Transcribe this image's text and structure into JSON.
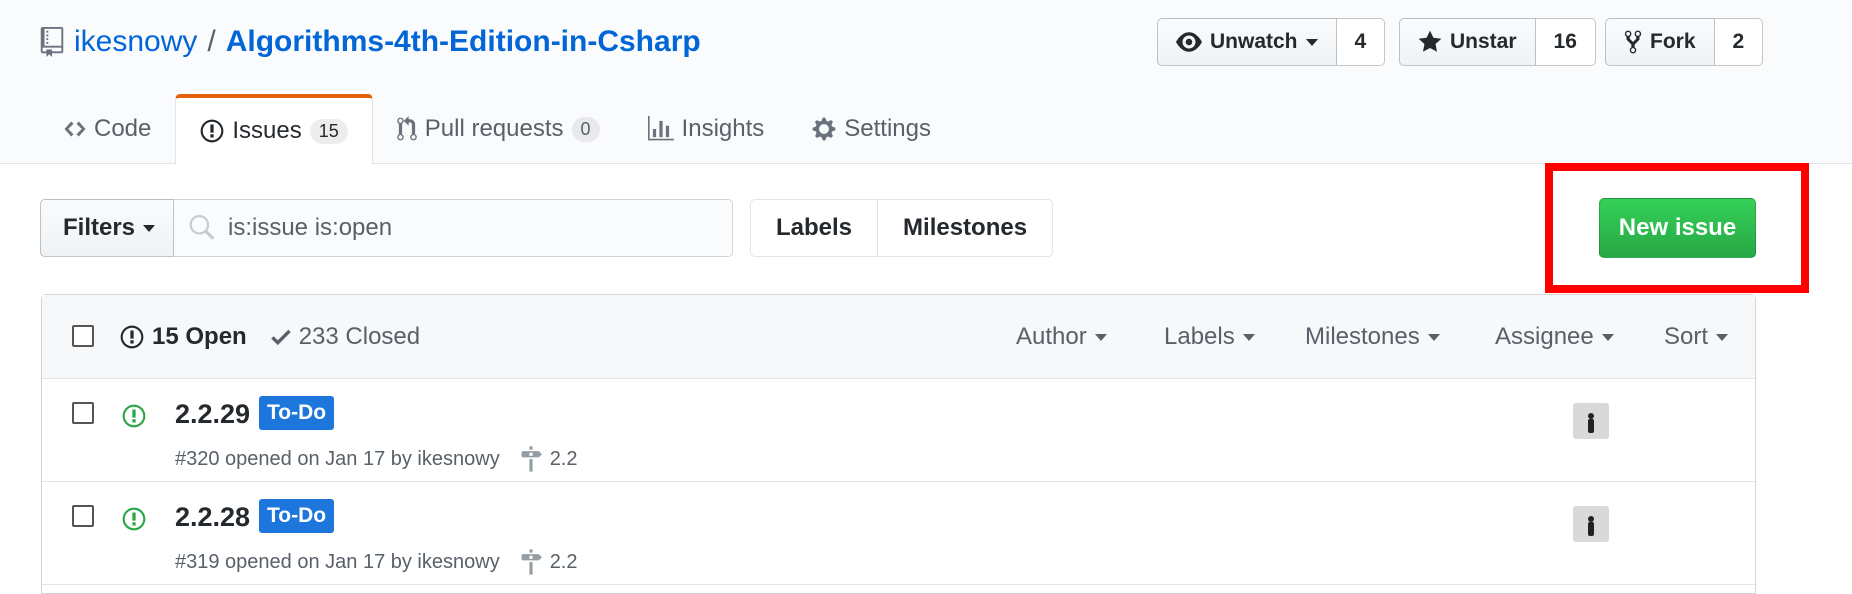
{
  "repo": {
    "owner": "ikesnowy",
    "separator": "/",
    "name": "Algorithms-4th-Edition-in-Csharp"
  },
  "actions": {
    "watch": {
      "label": "Unwatch",
      "count": "4"
    },
    "star": {
      "label": "Unstar",
      "count": "16"
    },
    "fork": {
      "label": "Fork",
      "count": "2"
    }
  },
  "nav": {
    "code": "Code",
    "issues": {
      "label": "Issues",
      "count": "15"
    },
    "pulls": {
      "label": "Pull requests",
      "count": "0"
    },
    "insights": "Insights",
    "settings": "Settings"
  },
  "subnav": {
    "filters_label": "Filters",
    "search_value": "is:issue is:open",
    "labels_label": "Labels",
    "milestones_label": "Milestones",
    "new_issue_label": "New issue"
  },
  "issues_header": {
    "open": "15 Open",
    "closed": "233 Closed",
    "author": "Author",
    "labels": "Labels",
    "milestones": "Milestones",
    "assignee": "Assignee",
    "sort": "Sort"
  },
  "issues": [
    {
      "title": "2.2.29",
      "label": "To-Do",
      "meta": "#320 opened on Jan 17 by ikesnowy",
      "milestone": "2.2"
    },
    {
      "title": "2.2.28",
      "label": "To-Do",
      "meta": "#319 opened on Jan 17 by ikesnowy",
      "milestone": "2.2"
    }
  ],
  "colors": {
    "link": "#0366d6",
    "new_issue_green": "#28a745",
    "label_todo": "#1d76db",
    "open_icon": "#28a745",
    "highlight": "#ff0000",
    "tab_accent": "#e36209"
  },
  "icons": {
    "repo": "repo-icon",
    "eye": "eye-icon",
    "star": "star-icon",
    "fork": "fork-icon",
    "code": "code-icon",
    "issue": "issue-opened-icon",
    "pull": "git-pull-request-icon",
    "graph": "graph-icon",
    "gear": "gear-icon",
    "search": "search-icon",
    "check": "check-icon",
    "milestone": "milestone-icon"
  }
}
